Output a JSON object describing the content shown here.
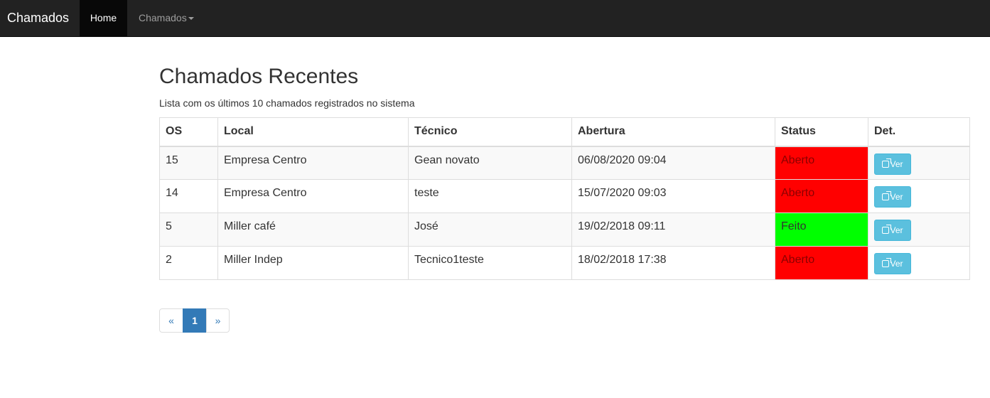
{
  "navbar": {
    "brand": "Chamados",
    "items": [
      {
        "label": "Home",
        "active": true
      },
      {
        "label": "Chamados",
        "dropdown": true
      }
    ]
  },
  "page": {
    "title": "Chamados Recentes",
    "subtitle": "Lista com os últimos 10 chamados registrados no sistema"
  },
  "table": {
    "headers": [
      "OS",
      "Local",
      "Técnico",
      "Abertura",
      "Status",
      "Det."
    ],
    "rows": [
      {
        "os": "15",
        "local": "Empresa Centro",
        "tecnico": "Gean novato",
        "abertura": "06/08/2020 09:04",
        "status": "Aberto",
        "status_color": "#ff0000",
        "action": "Ver"
      },
      {
        "os": "14",
        "local": "Empresa Centro",
        "tecnico": "teste",
        "abertura": "15/07/2020 09:03",
        "status": "Aberto",
        "status_color": "#ff0000",
        "action": "Ver"
      },
      {
        "os": "5",
        "local": "Miller café",
        "tecnico": "José",
        "abertura": "19/02/2018 09:11",
        "status": "Feito",
        "status_color": "#00ff00",
        "action": "Ver"
      },
      {
        "os": "2",
        "local": "Miller Indep",
        "tecnico": "Tecnico1teste",
        "abertura": "18/02/2018 17:38",
        "status": "Aberto",
        "status_color": "#ff0000",
        "action": "Ver"
      }
    ]
  },
  "pagination": {
    "prev": "«",
    "current": "1",
    "next": "»"
  },
  "colors": {
    "navbar_bg": "#222222",
    "info_button": "#5bc0de",
    "primary": "#337ab7",
    "status_open": "#ff0000",
    "status_done": "#00ff00"
  }
}
